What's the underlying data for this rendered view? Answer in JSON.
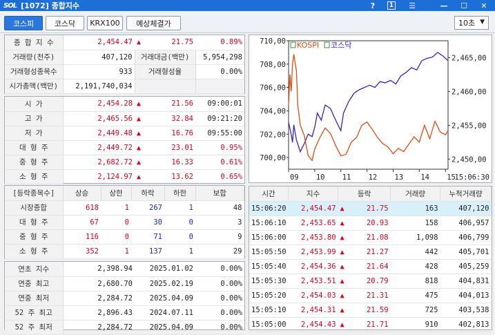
{
  "window": {
    "logo": "SOL",
    "title": "[1072] 종합지수",
    "help": "?",
    "page": "1",
    "menu": "☰",
    "minimize": "—",
    "maximize": "☐",
    "close": "✕"
  },
  "tabs": [
    {
      "label": "코스피",
      "active": true
    },
    {
      "label": "코스닥",
      "active": false
    },
    {
      "label": "KRX100",
      "active": false
    },
    {
      "label": "예상체결가",
      "active": false
    }
  ],
  "interval": "10초",
  "summary": {
    "composite_label": "종 합 지 수",
    "composite_value": "2,454.47",
    "composite_change": "21.75",
    "composite_rate": "0.89%",
    "volume_label": "거래량(천주)",
    "volume_value": "407,120",
    "amount_label": "거래대금(백만)",
    "amount_value": "5,954,298",
    "formed_count_label": "거래형성종목수",
    "formed_count_value": "933",
    "formed_rate_label": "거래형성율",
    "formed_rate_value": "0.00%",
    "mcap_label": "시가총액(백만)",
    "mcap_value": "2,191,740,034"
  },
  "prices": [
    {
      "label": "시      가",
      "value": "2,454.28",
      "change": "21.56",
      "extra": "09:00:01"
    },
    {
      "label": "고      가",
      "value": "2,465.56",
      "change": "32.84",
      "extra": "09:21:20"
    },
    {
      "label": "저      가",
      "value": "2,449.48",
      "change": "16.76",
      "extra": "09:55:00"
    },
    {
      "label": "대 형 주",
      "value": "2,449.72",
      "change": "23.01",
      "extra": "0.95%"
    },
    {
      "label": "중 형 주",
      "value": "2,682.72",
      "change": "16.33",
      "extra": "0.61%"
    },
    {
      "label": "소 형 주",
      "value": "2,124.97",
      "change": "13.62",
      "extra": "0.65%"
    }
  ],
  "breadth": {
    "headers": [
      "[등락종목수]",
      "상승",
      "상한",
      "하락",
      "하한",
      "보합"
    ],
    "rows": [
      {
        "label": "시장종합",
        "up": "618",
        "uplimit": "1",
        "down": "267",
        "downlimit": "1",
        "flat": "48"
      },
      {
        "label": "대 형 주",
        "up": "67",
        "uplimit": "0",
        "down": "30",
        "downlimit": "0",
        "flat": "3"
      },
      {
        "label": "중 형 주",
        "up": "116",
        "uplimit": "0",
        "down": "71",
        "downlimit": "0",
        "flat": "9"
      },
      {
        "label": "소 형 주",
        "up": "352",
        "uplimit": "1",
        "down": "137",
        "downlimit": "1",
        "flat": "29"
      }
    ]
  },
  "history": [
    {
      "label": "연초  지수",
      "value": "2,398.94",
      "date": "2025.01.02",
      "rate": "0.00%"
    },
    {
      "label": "연중  최고",
      "value": "2,680.70",
      "date": "2025.02.19",
      "rate": "0.00%"
    },
    {
      "label": "연중  최저",
      "value": "2,284.72",
      "date": "2025.04.09",
      "rate": "0.00%"
    },
    {
      "label": "52 주 최고",
      "value": "2,896.43",
      "date": "2024.07.11",
      "rate": "0.00%"
    },
    {
      "label": "52 주 최저",
      "value": "2,284.72",
      "date": "2025.04.09",
      "rate": "0.00%"
    }
  ],
  "ticks": {
    "headers": [
      "시간",
      "지수",
      "등락",
      "거래량",
      "누적거래량"
    ],
    "rows": [
      {
        "time": "15:06:20",
        "index": "2,454.47",
        "change": "21.75",
        "vol": "163",
        "cum": "407,120"
      },
      {
        "time": "15:06:10",
        "index": "2,453.65",
        "change": "20.93",
        "vol": "158",
        "cum": "406,957"
      },
      {
        "time": "15:06:00",
        "index": "2,453.80",
        "change": "21.08",
        "vol": "1,098",
        "cum": "406,799"
      },
      {
        "time": "15:05:50",
        "index": "2,453.99",
        "change": "21.27",
        "vol": "442",
        "cum": "405,701"
      },
      {
        "time": "15:05:40",
        "index": "2,454.36",
        "change": "21.64",
        "vol": "428",
        "cum": "405,259"
      },
      {
        "time": "15:05:30",
        "index": "2,453.51",
        "change": "20.79",
        "vol": "818",
        "cum": "404,831"
      },
      {
        "time": "15:05:20",
        "index": "2,454.03",
        "change": "21.31",
        "vol": "475",
        "cum": "404,013"
      },
      {
        "time": "15:05:10",
        "index": "2,454.31",
        "change": "21.59",
        "vol": "725",
        "cum": "403,538"
      },
      {
        "time": "15:05:00",
        "index": "2,454.43",
        "change": "21.71",
        "vol": "910",
        "cum": "402,813"
      }
    ]
  },
  "colors": {
    "kospi": "#e84a0c",
    "kosdaq": "#3a1ec8",
    "up": "#e1001c",
    "down": "#1a28c8",
    "accent": "#1d6fd8"
  },
  "chart_data": {
    "type": "line",
    "legend": [
      "KOSPI",
      "코스닥"
    ],
    "left_ticks": [
      "710,00",
      "708,00",
      "706,00",
      "704,00",
      "702,00",
      "700,00"
    ],
    "right_ticks": [
      "2,465,00",
      "2,460,00",
      "2,455,00",
      "2,450,00"
    ],
    "x_ticks": [
      "09",
      "10",
      "11",
      "12",
      "13",
      "14",
      "15"
    ],
    "time_label": "15:06:30",
    "kosdaq_range": [
      699,
      710
    ],
    "kospi_range": [
      2448.5,
      2467.5
    ],
    "series": [
      {
        "name": "코스닥",
        "axis": "left",
        "x": [
          9.0,
          9.05,
          9.1,
          9.15,
          9.2,
          9.3,
          9.45,
          9.6,
          9.75,
          9.9,
          10.0,
          10.1,
          10.25,
          10.4,
          10.6,
          10.8,
          11.0,
          11.1,
          11.3,
          11.5,
          11.7,
          11.9,
          12.1,
          12.3,
          12.5,
          12.7,
          12.9,
          13.1,
          13.3,
          13.5,
          13.7,
          13.9,
          14.1,
          14.3,
          14.5,
          14.7,
          14.9,
          15.1
        ],
        "values": [
          703.0,
          702.5,
          702.0,
          701.3,
          702.8,
          701.5,
          700.5,
          701.2,
          702.0,
          701.8,
          702.6,
          703.8,
          703.2,
          704.5,
          704.2,
          703.2,
          702.3,
          703.8,
          704.8,
          705.5,
          705.8,
          706.0,
          706.2,
          706.0,
          706.5,
          706.4,
          706.6,
          706.3,
          707.0,
          707.3,
          707.7,
          707.5,
          708.3,
          708.5,
          708.6,
          709.0,
          708.7,
          708.3
        ]
      },
      {
        "name": "KOSPI",
        "axis": "right",
        "x": [
          9.0,
          9.05,
          9.1,
          9.15,
          9.2,
          9.3,
          9.35,
          9.45,
          9.6,
          9.75,
          9.9,
          10.0,
          10.2,
          10.4,
          10.6,
          10.8,
          11.0,
          11.2,
          11.4,
          11.6,
          11.8,
          12.0,
          12.2,
          12.4,
          12.6,
          12.8,
          13.0,
          13.2,
          13.4,
          13.6,
          13.8,
          14.0,
          14.2,
          14.4,
          14.6,
          14.8,
          15.0,
          15.1
        ],
        "values": [
          2458.0,
          2462.5,
          2460.0,
          2464.0,
          2465.5,
          2463.0,
          2458.0,
          2455.0,
          2453.5,
          2450.5,
          2449.8,
          2451.5,
          2453.2,
          2454.6,
          2453.8,
          2452.0,
          2450.5,
          2450.7,
          2452.5,
          2453.2,
          2455.0,
          2455.5,
          2454.4,
          2453.2,
          2452.3,
          2451.8,
          2450.8,
          2451.6,
          2451.1,
          2452.2,
          2453.3,
          2452.5,
          2455.0,
          2453.0,
          2455.6,
          2454.0,
          2453.6,
          2454.2
        ]
      }
    ]
  }
}
